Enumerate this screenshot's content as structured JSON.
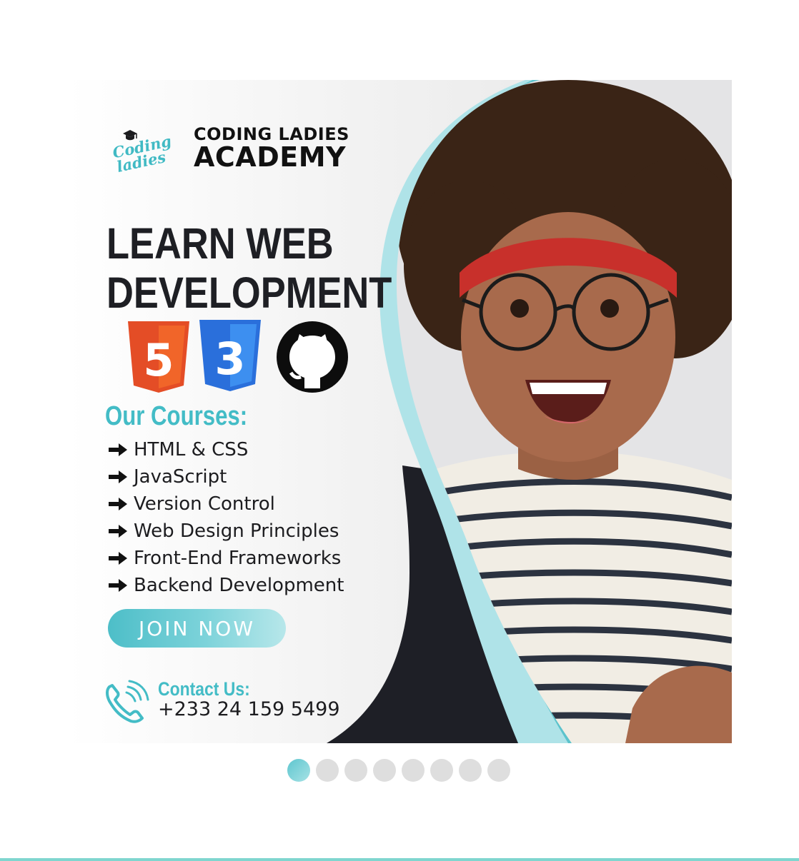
{
  "brand": {
    "logo_line1": "Coding",
    "logo_line2": "ladies",
    "academy_line1": "CODING LADIES",
    "academy_line2": "ACADEMY"
  },
  "headline": {
    "line1": "LEARN WEB",
    "line2": "DEVELOPMENT"
  },
  "tech_logos": {
    "html5": "5",
    "css3": "3"
  },
  "courses": {
    "title": "Our Courses:",
    "items": [
      "HTML & CSS",
      "JavaScript",
      "Version Control",
      "Web Design Principles",
      "Front-End Frameworks",
      "Backend Development"
    ]
  },
  "cta": {
    "label": "JOIN NOW"
  },
  "contact": {
    "label": "Contact Us:",
    "phone": "+233 24 159 5499"
  },
  "carousel": {
    "slide_count": 8,
    "active_index": 0
  },
  "colors": {
    "accent_teal": "#43bcc6",
    "dark_navy": "#1e1f26",
    "light_teal": "#acdfe5",
    "html5_orange": "#e44d26",
    "css3_blue": "#2a6fdb"
  },
  "icons": [
    "graduation-cap-icon",
    "html5-icon",
    "css3-icon",
    "github-icon",
    "arrow-right-icon",
    "phone-icon"
  ]
}
